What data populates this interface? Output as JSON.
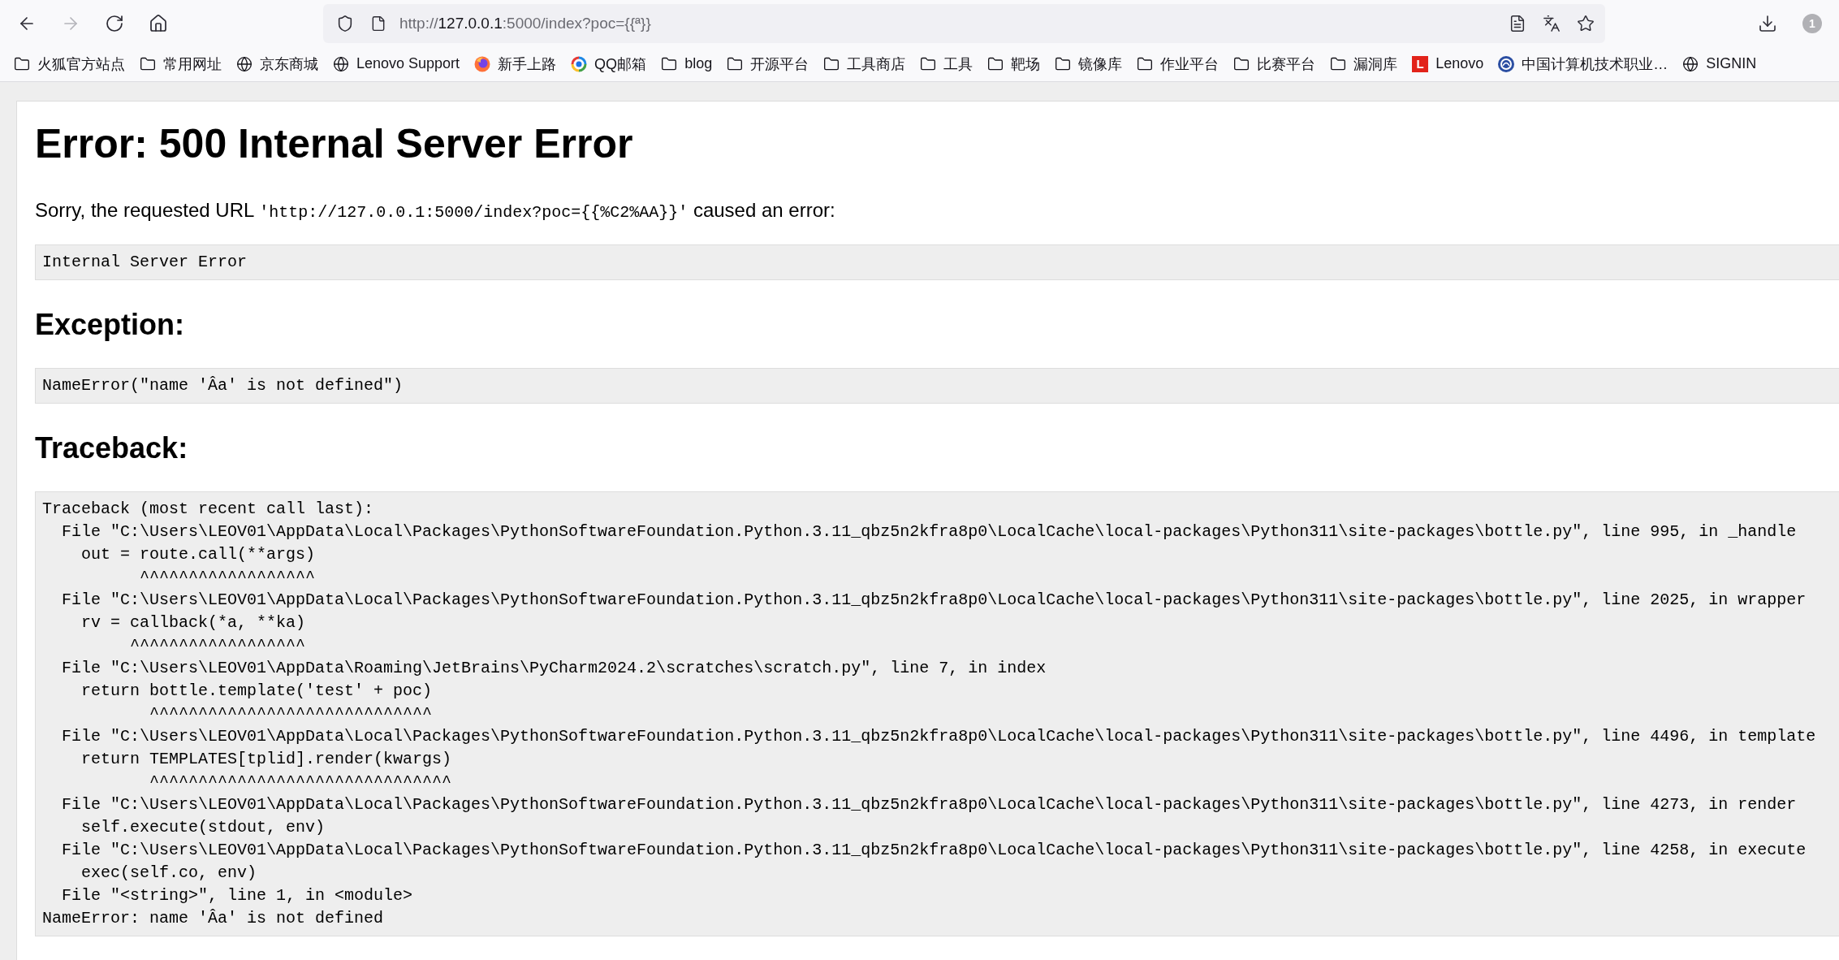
{
  "browser": {
    "nav_buttons": [
      {
        "kind": "back",
        "disabled": false
      },
      {
        "kind": "forward",
        "disabled": true
      },
      {
        "kind": "reload",
        "disabled": false
      },
      {
        "kind": "home",
        "disabled": false
      }
    ],
    "address_bar": {
      "scheme": "http://",
      "host": "127.0.0.1",
      "rest": ":5000/index?poc={{ª}}"
    },
    "profile_count": "1",
    "bookmarks": [
      {
        "kind": "folder",
        "label": "火狐官方站点"
      },
      {
        "kind": "folder",
        "label": "常用网址"
      },
      {
        "kind": "globe",
        "label": "京东商城"
      },
      {
        "kind": "globe",
        "label": "Lenovo Support"
      },
      {
        "kind": "firefox",
        "label": "新手上路"
      },
      {
        "kind": "mail",
        "label": "QQ邮箱"
      },
      {
        "kind": "folder",
        "label": "blog"
      },
      {
        "kind": "folder",
        "label": "开源平台"
      },
      {
        "kind": "folder",
        "label": "工具商店"
      },
      {
        "kind": "folder",
        "label": "工具"
      },
      {
        "kind": "folder",
        "label": "靶场"
      },
      {
        "kind": "folder",
        "label": "镜像库"
      },
      {
        "kind": "folder",
        "label": "作业平台"
      },
      {
        "kind": "folder",
        "label": "比赛平台"
      },
      {
        "kind": "folder",
        "label": "漏洞库"
      },
      {
        "kind": "letter",
        "letter": "L",
        "label": "Lenovo"
      },
      {
        "kind": "emblem",
        "label": "中国计算机技术职业…"
      },
      {
        "kind": "globe",
        "label": "SIGNIN"
      }
    ]
  },
  "page": {
    "title": "Error: 500 Internal Server Error",
    "message": {
      "before": "Sorry, the requested URL",
      "url": "'http://127.0.0.1:5000/index?poc={{%C2%AA}}'",
      "after": "caused an error:"
    },
    "error_text": "Internal Server Error",
    "exception_heading": "Exception:",
    "exception_text": "NameError(\"name 'Âa' is not defined\")",
    "traceback_heading": "Traceback:",
    "traceback_lines": [
      "Traceback (most recent call last):",
      "  File \"C:\\Users\\LEOV01\\AppData\\Local\\Packages\\PythonSoftwareFoundation.Python.3.11_qbz5n2kfra8p0\\LocalCache\\local-packages\\Python311\\site-packages\\bottle.py\", line 995, in _handle",
      "    out = route.call(**args)",
      "          ^^^^^^^^^^^^^^^^^^",
      "  File \"C:\\Users\\LEOV01\\AppData\\Local\\Packages\\PythonSoftwareFoundation.Python.3.11_qbz5n2kfra8p0\\LocalCache\\local-packages\\Python311\\site-packages\\bottle.py\", line 2025, in wrapper",
      "    rv = callback(*a, **ka)",
      "         ^^^^^^^^^^^^^^^^^^",
      "  File \"C:\\Users\\LEOV01\\AppData\\Roaming\\JetBrains\\PyCharm2024.2\\scratches\\scratch.py\", line 7, in index",
      "    return bottle.template('test' + poc)",
      "           ^^^^^^^^^^^^^^^^^^^^^^^^^^^^^",
      "  File \"C:\\Users\\LEOV01\\AppData\\Local\\Packages\\PythonSoftwareFoundation.Python.3.11_qbz5n2kfra8p0\\LocalCache\\local-packages\\Python311\\site-packages\\bottle.py\", line 4496, in template",
      "    return TEMPLATES[tplid].render(kwargs)",
      "           ^^^^^^^^^^^^^^^^^^^^^^^^^^^^^^^",
      "  File \"C:\\Users\\LEOV01\\AppData\\Local\\Packages\\PythonSoftwareFoundation.Python.3.11_qbz5n2kfra8p0\\LocalCache\\local-packages\\Python311\\site-packages\\bottle.py\", line 4273, in render",
      "    self.execute(stdout, env)",
      "  File \"C:\\Users\\LEOV01\\AppData\\Local\\Packages\\PythonSoftwareFoundation.Python.3.11_qbz5n2kfra8p0\\LocalCache\\local-packages\\Python311\\site-packages\\bottle.py\", line 4258, in execute",
      "    exec(self.co, env)",
      "  File \"<string>\", line 1, in <module>",
      "NameError: name 'Âa' is not defined"
    ]
  }
}
